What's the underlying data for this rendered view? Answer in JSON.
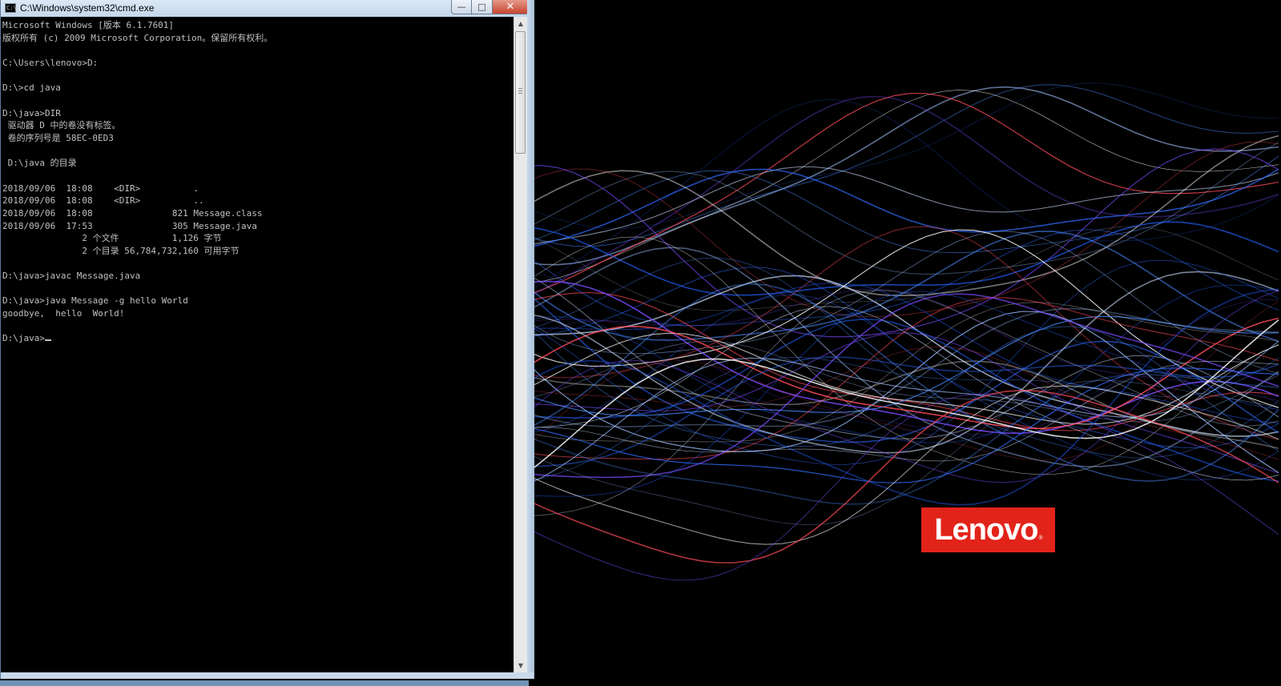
{
  "window": {
    "title": "C:\\Windows\\system32\\cmd.exe",
    "buttons": {
      "minimize": "—",
      "maximize": "□",
      "close": "✕"
    }
  },
  "console": {
    "lines": [
      "Microsoft Windows [版本 6.1.7601]",
      "版权所有 (c) 2009 Microsoft Corporation。保留所有权利。",
      "",
      "C:\\Users\\lenovo>D:",
      "",
      "D:\\>cd java",
      "",
      "D:\\java>DIR",
      " 驱动器 D 中的卷没有标签。",
      " 卷的序列号是 58EC-0ED3",
      "",
      " D:\\java 的目录",
      "",
      "2018/09/06  18:08    <DIR>          .",
      "2018/09/06  18:08    <DIR>          ..",
      "2018/09/06  18:08               821 Message.class",
      "2018/09/06  17:53               305 Message.java",
      "               2 个文件          1,126 字节",
      "               2 个目录 56,784,732,160 可用字节",
      "",
      "D:\\java>javac Message.java",
      "",
      "D:\\java>java Message -g hello World",
      "goodbye,  hello  World!",
      ""
    ],
    "prompt": "D:\\java>"
  },
  "wallpaper": {
    "brand": "Lenovo",
    "trademark": "®",
    "brand_color": "#e2231a"
  },
  "icons": {
    "app": "cmd-icon",
    "scroll_up": "▲",
    "scroll_down": "▼"
  }
}
